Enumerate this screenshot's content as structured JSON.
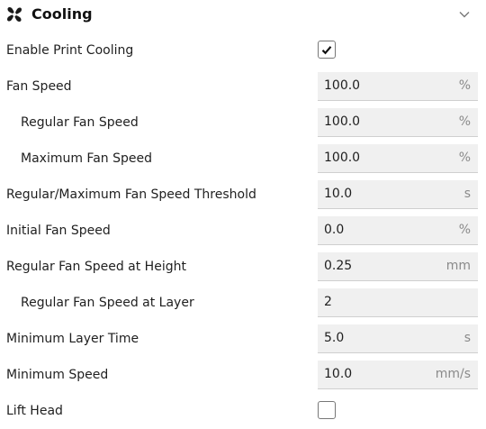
{
  "section": {
    "title": "Cooling",
    "icon": "fan-icon",
    "collapse_icon": "chevron-down-icon"
  },
  "settings": [
    {
      "label": "Enable Print Cooling",
      "type": "checkbox",
      "checked": true
    },
    {
      "label": "Fan Speed",
      "type": "field",
      "value": "100.0",
      "unit": "%"
    },
    {
      "label": "Regular Fan Speed",
      "type": "field",
      "value": "100.0",
      "unit": "%"
    },
    {
      "label": "Maximum Fan Speed",
      "type": "field",
      "value": "100.0",
      "unit": "%"
    },
    {
      "label": "Regular/Maximum Fan Speed Threshold",
      "type": "field",
      "value": "10.0",
      "unit": "s"
    },
    {
      "label": "Initial Fan Speed",
      "type": "field",
      "value": "0.0",
      "unit": "%"
    },
    {
      "label": "Regular Fan Speed at Height",
      "type": "field",
      "value": "0.25",
      "unit": "mm"
    },
    {
      "label": "Regular Fan Speed at Layer",
      "type": "field",
      "value": "2",
      "unit": ""
    },
    {
      "label": "Minimum Layer Time",
      "type": "field",
      "value": "5.0",
      "unit": "s"
    },
    {
      "label": "Minimum Speed",
      "type": "field",
      "value": "10.0",
      "unit": "mm/s"
    },
    {
      "label": "Lift Head",
      "type": "checkbox",
      "checked": false
    }
  ]
}
